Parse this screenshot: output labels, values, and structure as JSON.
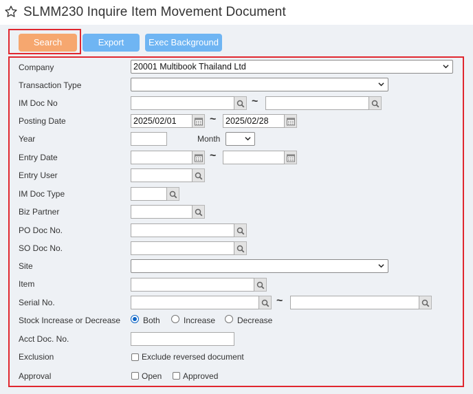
{
  "window": {
    "title": "SLMM230 Inquire Item Movement Document"
  },
  "toolbar": {
    "search_label": "Search",
    "export_label": "Export",
    "exec_label": "Exec Background"
  },
  "labels": {
    "company": "Company",
    "transaction_type": "Transaction Type",
    "im_doc_no": "IM Doc No",
    "posting_date": "Posting Date",
    "year": "Year",
    "month": "Month",
    "entry_date": "Entry Date",
    "entry_user": "Entry User",
    "im_doc_type": "IM Doc Type",
    "biz_partner": "Biz Partner",
    "po_doc_no": "PO Doc No.",
    "so_doc_no": "SO Doc No.",
    "site": "Site",
    "item": "Item",
    "serial_no": "Serial No.",
    "stock_inc_dec": "Stock Increase or Decrease",
    "acct_doc_no": "Acct Doc. No.",
    "exclusion": "Exclusion",
    "approval": "Approval"
  },
  "values": {
    "company": "20001 Multibook Thailand Ltd",
    "transaction_type": "",
    "posting_date_from": "2025/02/01",
    "posting_date_to": "2025/02/28",
    "month": ""
  },
  "range_separator": "~",
  "stock_options": {
    "both": "Both",
    "increase": "Increase",
    "decrease": "Decrease",
    "selected": "Both"
  },
  "exclusion": {
    "exclude_reversed": "Exclude reversed document"
  },
  "approval": {
    "open": "Open",
    "approved": "Approved"
  },
  "icons": {
    "star": "star-outline-icon",
    "search": "magnifier-icon",
    "calendar": "calendar-icon",
    "dropdown": "chevron-down-icon"
  },
  "colors": {
    "search_button": "#f6a76f",
    "action_button": "#6fb5f3",
    "highlight": "#e0262e",
    "panel": "#eef1f5"
  }
}
